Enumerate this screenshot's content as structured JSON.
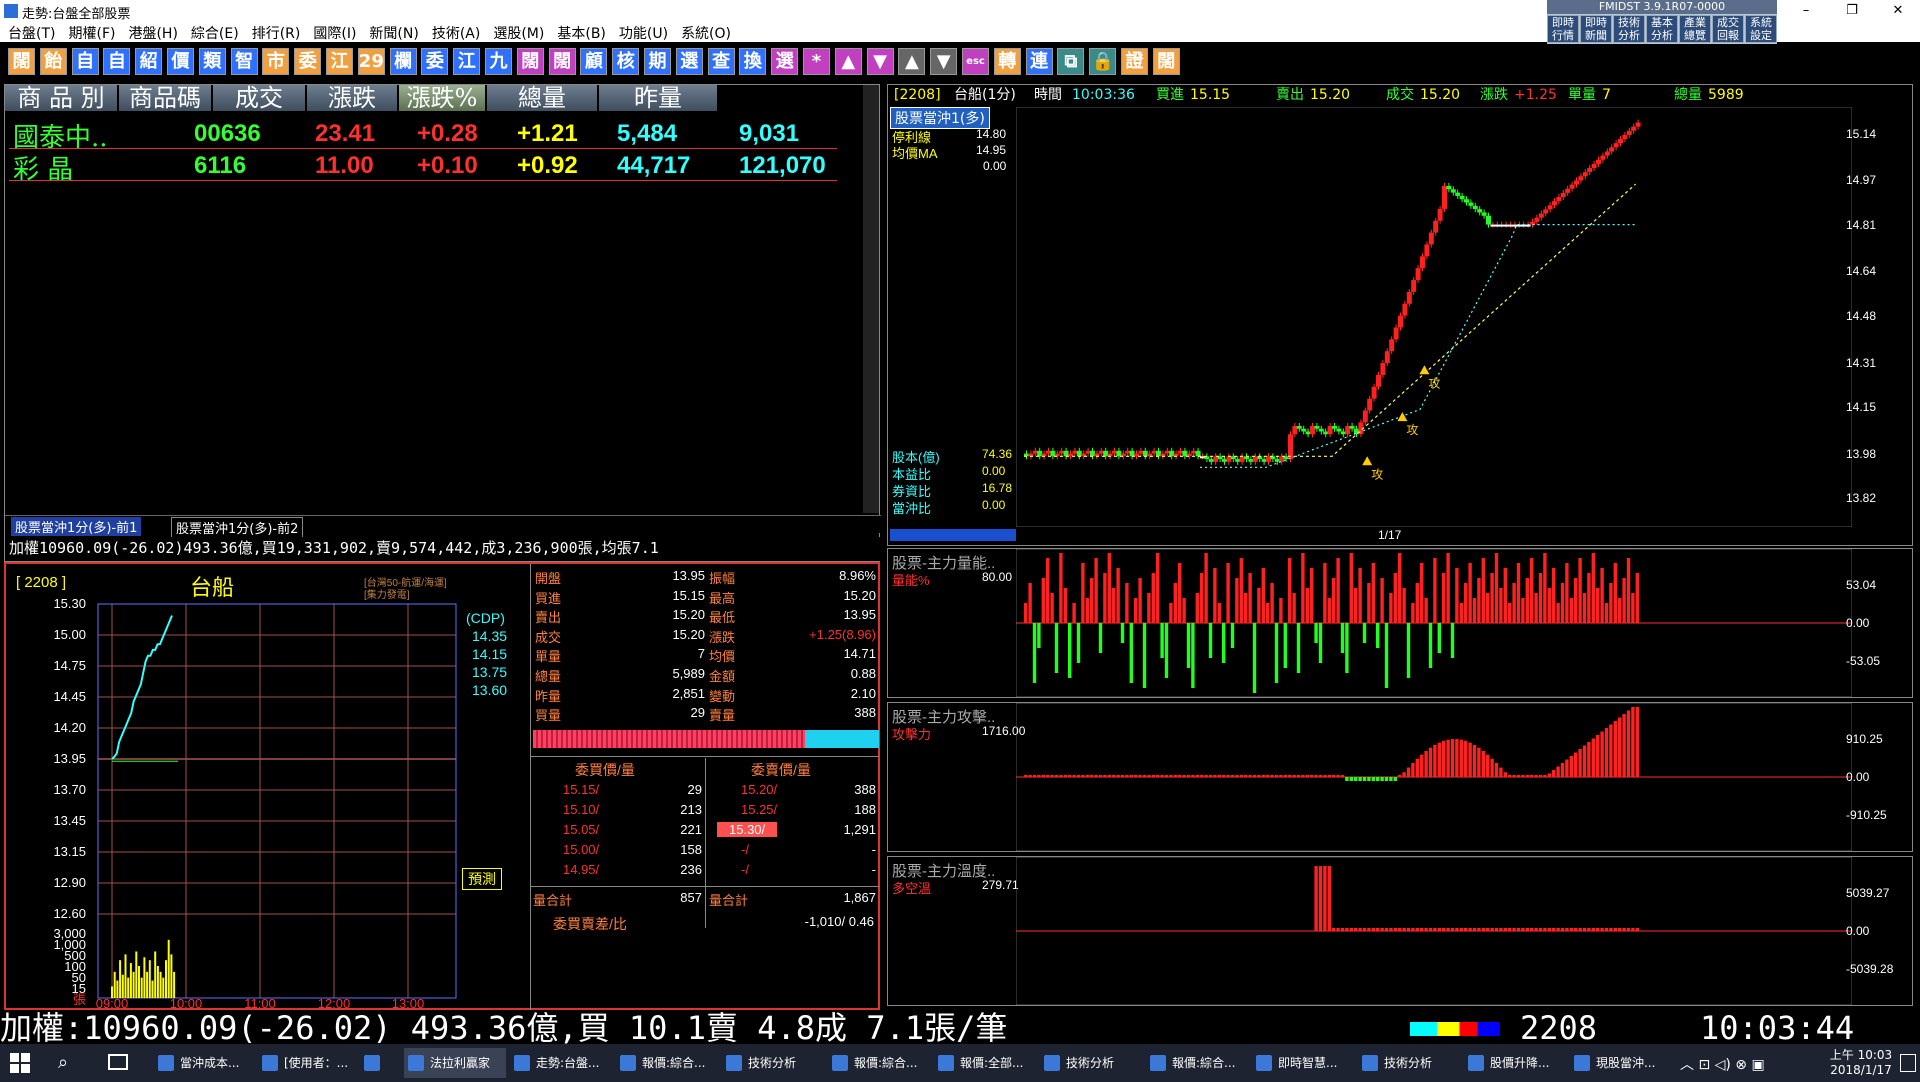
{
  "window": {
    "title": "走勢:台盤全部股票",
    "minimize": "–",
    "restore": "❐",
    "close": "✕"
  },
  "menu": [
    "台盤(T)",
    "期權(F)",
    "港盤(H)",
    "綜合(E)",
    "排行(R)",
    "國際(I)",
    "新聞(N)",
    "技術(A)",
    "選股(M)",
    "基本(B)",
    "功能(U)",
    "系統(O)"
  ],
  "quick_panel": {
    "version": "FMIDST 3.9.1R07-0000",
    "buttons": [
      "即時\n行情",
      "即時\n新聞",
      "技術\n分析",
      "基本\n分析",
      "產業\n總覽",
      "成交\n回報",
      "系統\n設定"
    ]
  },
  "toolbar": [
    {
      "t": "闊",
      "c": "#f0a040"
    },
    {
      "t": "飴",
      "c": "#f0a040"
    },
    {
      "t": "自",
      "c": "#3070ff"
    },
    {
      "t": "自",
      "c": "#3070ff"
    },
    {
      "t": "紹",
      "c": "#3070ff"
    },
    {
      "t": "價",
      "c": "#3070ff"
    },
    {
      "t": "類",
      "c": "#3070ff"
    },
    {
      "t": "智",
      "c": "#3070ff"
    },
    {
      "t": "市",
      "c": "#f0a040"
    },
    {
      "t": "委",
      "c": "#f0a040"
    },
    {
      "t": "江",
      "c": "#f0a040"
    },
    {
      "t": "29",
      "c": "#f0a040"
    },
    {
      "t": "欄",
      "c": "#3070ff"
    },
    {
      "t": "委",
      "c": "#3070ff"
    },
    {
      "t": "江",
      "c": "#3070ff"
    },
    {
      "t": "九",
      "c": "#3070ff"
    },
    {
      "t": "闊",
      "c": "#c040c0"
    },
    {
      "t": "闊",
      "c": "#c040c0"
    },
    {
      "t": "顧",
      "c": "#3070ff"
    },
    {
      "t": "核",
      "c": "#3070ff"
    },
    {
      "t": "期",
      "c": "#3070ff"
    },
    {
      "t": "選",
      "c": "#3070ff"
    },
    {
      "t": "查",
      "c": "#3070ff"
    },
    {
      "t": "換",
      "c": "#3070ff"
    },
    {
      "t": "選",
      "c": "#c040c0"
    },
    {
      "t": "*",
      "c": "#c040c0"
    },
    {
      "t": "▲",
      "c": "#c040c0"
    },
    {
      "t": "▼",
      "c": "#c040c0"
    },
    {
      "t": "▲",
      "c": "#666"
    },
    {
      "t": "▼",
      "c": "#666"
    },
    {
      "t": "esc",
      "c": "#c040c0"
    },
    {
      "t": "轉",
      "c": "#f0a040"
    },
    {
      "t": "連",
      "c": "#3070ff"
    },
    {
      "t": "⧉",
      "c": "#3a8a8a"
    },
    {
      "t": "🔒",
      "c": "#3a8a8a"
    },
    {
      "t": "證",
      "c": "#f0a040"
    },
    {
      "t": "闊",
      "c": "#f0a040"
    }
  ],
  "quotes": {
    "headers": [
      "商 品 別",
      "商品碼",
      "成交",
      "漲跌",
      "漲跌%",
      "總量",
      "昨量"
    ],
    "rows": [
      {
        "name": "國泰中..",
        "code": "00636",
        "price": "23.41",
        "chg": "+0.28",
        "pct": "+1.21",
        "vol": "5,484",
        "yvol": "9,031"
      },
      {
        "name": "彩  晶",
        "code": "6116",
        "price": "11.00",
        "chg": "+0.10",
        "pct": "+0.92",
        "vol": "44,717",
        "yvol": "121,070"
      }
    ],
    "tabs": [
      "股票當沖1分(多)-前1",
      "股票當沖1分(多)-前2"
    ],
    "status": "加權10960.09(-26.02)493.36億,買19,331,902,賣9,574,442,成3,236,900張,均張7.1"
  },
  "intraday": {
    "code": "[ 2208 ]",
    "name": "台船",
    "tag1": "[台灣50-航運/海運]",
    "tag2": "[集力發電]",
    "cdp_label": "(CDP)",
    "cdp": [
      "14.35",
      "14.15",
      "13.75",
      "13.60"
    ],
    "predict_button": "預測",
    "y_price": [
      "15.30",
      "15.00",
      "14.75",
      "14.45",
      "14.20",
      "13.95",
      "13.70",
      "13.45",
      "13.15",
      "12.90",
      "12.60"
    ],
    "y_vol": [
      "3,000",
      "1,000",
      "500",
      "100",
      "50",
      "15",
      "張"
    ],
    "x_time": [
      "09:00",
      "10:00",
      "11:00",
      "12:00",
      "13:00"
    ],
    "price_series": [
      13.95,
      13.97,
      14.0,
      14.1,
      14.15,
      14.2,
      14.25,
      14.3,
      14.35,
      14.45,
      14.5,
      14.55,
      14.6,
      14.7,
      14.8,
      14.85,
      14.85,
      14.9,
      14.9,
      14.95,
      14.95,
      15.0,
      15.05,
      15.1,
      15.15,
      15.2
    ],
    "vol_series": [
      40,
      90,
      60,
      130,
      80,
      150,
      70,
      120,
      90,
      160,
      110,
      70,
      140,
      90,
      130,
      60,
      160,
      110,
      90,
      70,
      130,
      200,
      150,
      90
    ]
  },
  "detail": {
    "rows": [
      [
        "開盤",
        "13.95",
        "振幅",
        "8.96%"
      ],
      [
        "買進",
        "15.15",
        "最高",
        "15.20"
      ],
      [
        "賣出",
        "15.20",
        "最低",
        "13.95"
      ],
      [
        "成交",
        "15.20",
        "漲跌",
        "+1.25(8.96)"
      ],
      [
        "單量",
        "7",
        "均價",
        "14.71"
      ],
      [
        "總量",
        "5,989",
        "金額",
        "0.88"
      ],
      [
        "昨量",
        "2,851",
        "變動",
        "2.10"
      ],
      [
        "買量",
        "29",
        "賣量",
        "388"
      ]
    ],
    "book_headers": [
      "委買價/量",
      "委賣價/量"
    ],
    "book": [
      [
        "15.15/",
        "29",
        "15.20/",
        "388"
      ],
      [
        "15.10/",
        "213",
        "15.25/",
        "188"
      ],
      [
        "15.05/",
        "221",
        "15.30/",
        "1,291"
      ],
      [
        "15.00/",
        "158",
        "-/",
        "-"
      ],
      [
        "14.95/",
        "236",
        "-/",
        "-"
      ]
    ],
    "totals": [
      "量合計",
      "857",
      "量合計",
      "1,867"
    ],
    "diff_label": "委買賣差/比",
    "diff": "-1,010/  0.46"
  },
  "kline": {
    "header": {
      "code": "[2208]",
      "name": "台船(1分)",
      "time_label": "時間",
      "time": "10:03:36",
      "bid_label": "買進",
      "bid": "15.15",
      "ask_label": "賣出",
      "ask": "15.20",
      "last_label": "成交",
      "last": "15.20",
      "chg_label": "漲跌",
      "chg": "+1.25",
      "unit_label": "單量",
      "unit": "7",
      "vol_label": "總量",
      "vol": "5989"
    },
    "strategy": "股票當沖1(多)",
    "stop_label": "停利線",
    "stop": "14.80",
    "ma_label": "均價MA",
    "ma": "14.95",
    "zero": "0.00",
    "stats": [
      [
        "股本(億)",
        "74.36"
      ],
      [
        "本益比",
        "0.00"
      ],
      [
        "券資比",
        "16.78"
      ],
      [
        "當沖比",
        "0.00"
      ]
    ],
    "date": "1/17",
    "y": [
      "15.14",
      "14.97",
      "14.81",
      "14.64",
      "14.48",
      "14.31",
      "14.15",
      "13.98",
      "13.82"
    ],
    "attack_marker": "攻"
  },
  "indicators": [
    {
      "title": "股票-主力量能..",
      "label": "量能%",
      "value": "80.00",
      "y": [
        "53.04",
        "0.00",
        "-53.05"
      ]
    },
    {
      "title": "股票-主力攻擊..",
      "label": "攻擊力",
      "value": "1716.00",
      "y": [
        "910.25",
        "0.00",
        "-910.25"
      ]
    },
    {
      "title": "股票-主力溫度..",
      "label": "多空溫",
      "value": "279.71",
      "y": [
        "5039.27",
        "0.00",
        "-5039.28"
      ]
    }
  ],
  "ticker": {
    "text": "加權:10960.09(-26.02) 493.36億,買 10.1賣 4.8成 7.1張/筆",
    "code": "2208",
    "time": "10:03:44"
  },
  "taskbar": {
    "items": [
      "當沖成本...",
      "[使用者：...",
      "",
      "法拉利贏家",
      "走勢:台盤...",
      "報價:綜合...",
      "技術分析",
      "報價:綜合...",
      "報價:全部...",
      "技術分析",
      "報價:綜合...",
      "即時智慧...",
      "技術分析",
      "股價升降...",
      "現股當沖..."
    ],
    "clock_time": "上午 10:03",
    "clock_date": "2018/1/17"
  },
  "colors": {
    "up": "#ff2020",
    "down": "#20ff20",
    "bg": "#000000"
  }
}
